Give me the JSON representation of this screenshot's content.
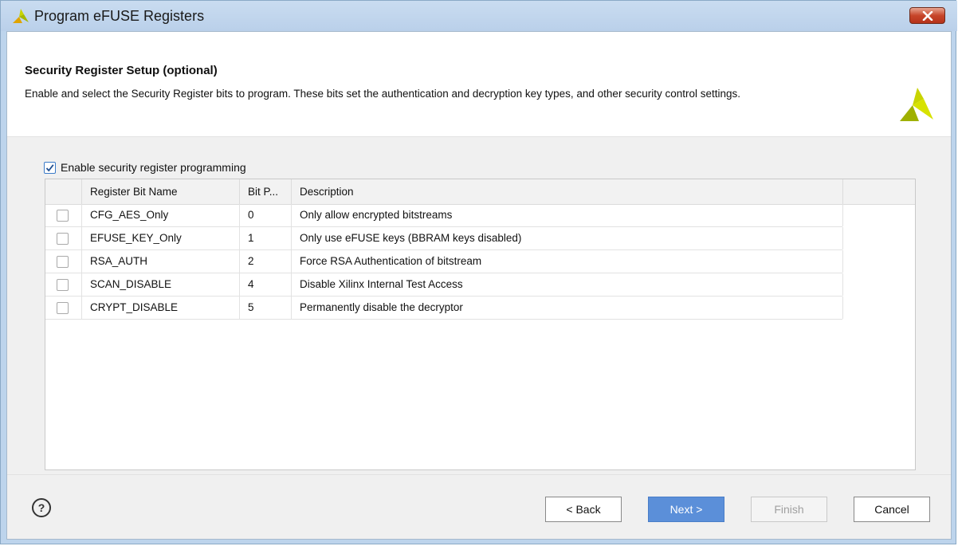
{
  "window": {
    "title": "Program eFUSE Registers"
  },
  "header": {
    "title": "Security Register Setup (optional)",
    "description": "Enable and select the Security Register bits to program. These bits set the authentication and decryption key types, and other security control settings."
  },
  "enable_checkbox": {
    "label": "Enable security register programming",
    "checked": true
  },
  "table": {
    "columns": [
      "Register Bit Name",
      "Bit P...",
      "Description"
    ],
    "rows": [
      {
        "name": "CFG_AES_Only",
        "bit": "0",
        "description": "Only allow encrypted bitstreams",
        "checked": false
      },
      {
        "name": "EFUSE_KEY_Only",
        "bit": "1",
        "description": "Only use eFUSE keys (BBRAM keys disabled)",
        "checked": false
      },
      {
        "name": "RSA_AUTH",
        "bit": "2",
        "description": "Force RSA Authentication of bitstream",
        "checked": false
      },
      {
        "name": "SCAN_DISABLE",
        "bit": "4",
        "description": "Disable Xilinx Internal Test Access",
        "checked": false
      },
      {
        "name": "CRYPT_DISABLE",
        "bit": "5",
        "description": "Permanently disable the decryptor",
        "checked": false
      }
    ]
  },
  "footer": {
    "help": "?",
    "back_label": "< Back",
    "next_label": "Next >",
    "finish_label": "Finish",
    "cancel_label": "Cancel"
  },
  "colors": {
    "titlebar": "#bad0ea",
    "next_button": "#5b8fd9",
    "logo_yellow": "#c8d400"
  },
  "icons": {
    "title_logo": "xilinx-logo-icon",
    "header_logo": "xilinx-logo-icon",
    "close": "close-icon",
    "help": "help-icon"
  }
}
